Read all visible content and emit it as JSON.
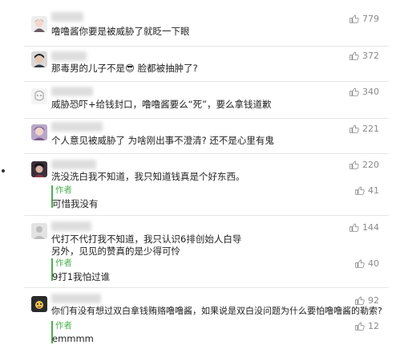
{
  "colors": {
    "author_green": "#4caf50",
    "like_gray": "#8a8a8a"
  },
  "comments": [
    {
      "avatar": "avatar-girl-icon",
      "text": "噜噜酱你要是被威胁了就眨一下眼",
      "likes": "779"
    },
    {
      "avatar": "avatar-boy-icon",
      "text": "那毒男的儿子不是😎 脸都被抽肿了?",
      "likes": "372"
    },
    {
      "avatar": "avatar-sketch-icon",
      "text": "威胁恐吓+给钱封口，噜噜酱要么“死”，要么拿钱道歉",
      "likes": "340"
    },
    {
      "avatar": "avatar-purple-icon",
      "text": "个人意见被威胁了 为啥刚出事不澄清? 还不是心里有鬼",
      "likes": "221"
    },
    {
      "avatar": "avatar-dark-icon",
      "text": "洗没洗白我不知道，我只知道钱真是个好东西。",
      "likes": "220",
      "reply": {
        "tag": "作者",
        "text": "可惜我没有",
        "likes": "41"
      }
    },
    {
      "avatar": "avatar-gray-icon",
      "text_lines": [
        "代打不代打我不知道，我只认识6排创始人白导",
        "另外，见见的赞真的是少得可怜"
      ],
      "likes": "144",
      "reply": {
        "tag": "作者",
        "text": "9打1我怕过谁",
        "likes": "40"
      }
    },
    {
      "avatar": "avatar-cartoon-icon",
      "text": "你们有没有想过双白拿钱贿赂噜噜酱，如果说是双白没问题为什么要怕噜噜酱的勒索?",
      "likes": "92",
      "reply": {
        "tag": "作者",
        "text": "emmmm",
        "likes": "12"
      }
    }
  ]
}
